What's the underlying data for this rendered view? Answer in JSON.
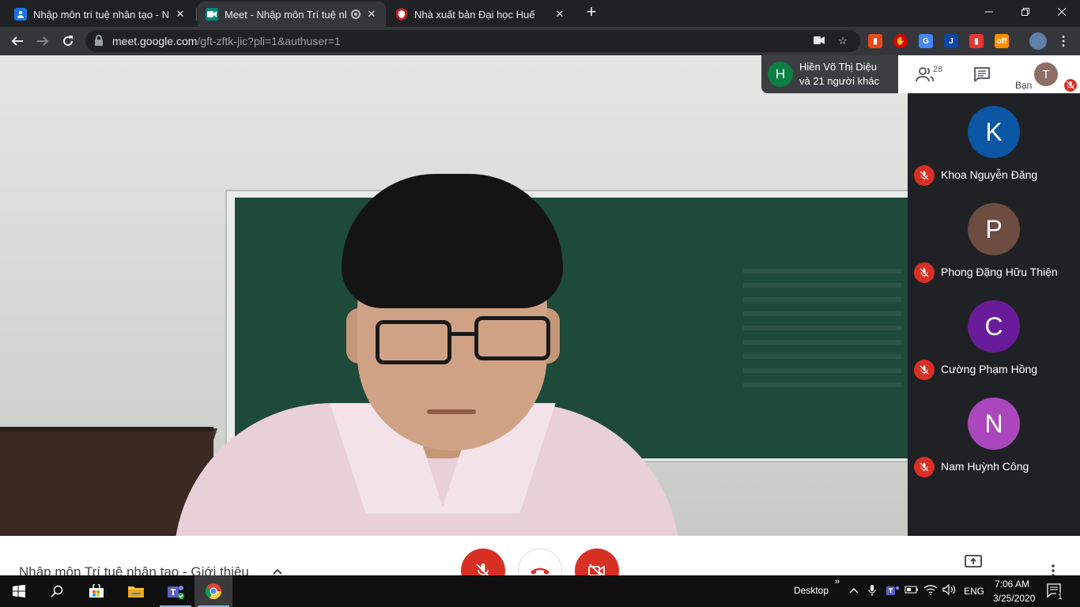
{
  "browser": {
    "tabs": [
      {
        "title": "Nhập môn trí tuệ nhân tạo - Nhó",
        "favicon": "classroom-icon",
        "color": "#1a73e8"
      },
      {
        "title": "Meet - Nhập môn Trí tuệ nhâ",
        "favicon": "meet-icon",
        "color": "#00897b"
      },
      {
        "title": "Nhà xuất bản Đại học Huế",
        "favicon": "shield-icon",
        "color": "#c62828"
      }
    ],
    "new_tab": "+",
    "url_host": "meet.google.com",
    "url_path": "/gft-zftk-jic?pli=1&authuser=1"
  },
  "meet": {
    "presenter": {
      "initial": "H",
      "line1": "Hiền Võ Thị Diệu",
      "line2": "và 21 người khác"
    },
    "people_count": "28",
    "me_label": "Bạn",
    "me_initial": "T",
    "participants": [
      {
        "initial": "K",
        "name": "Khoa Nguyễn Đăng",
        "color": "#0b57a4"
      },
      {
        "initial": "P",
        "name": "Phong Đặng Hữu Thiện",
        "color": "#6d4c41"
      },
      {
        "initial": "C",
        "name": "Cường Phạm Hồng",
        "color": "#6a1b9a"
      },
      {
        "initial": "N",
        "name": "Nam Huỳnh Công",
        "color": "#ab47bc"
      }
    ],
    "meeting_title": "Nhập môn Trí tuệ nhân tạo - Giới thiệu"
  },
  "taskbar": {
    "desktop_label": "Desktop",
    "chevron": "»",
    "lang": "ENG",
    "time": "7:06 AM",
    "date": "3/25/2020",
    "notification_count": "1"
  }
}
